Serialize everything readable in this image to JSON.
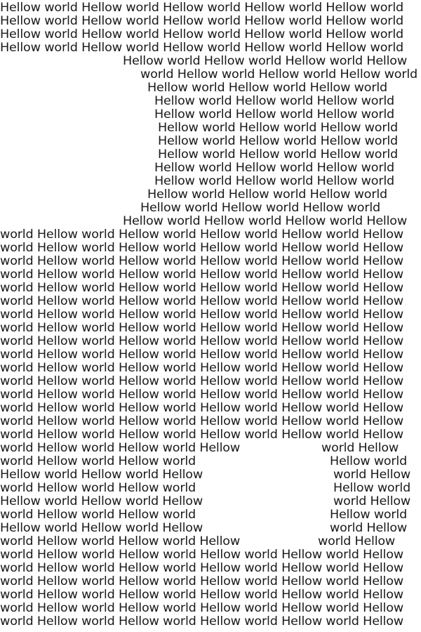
{
  "lines": [
    {
      "segments": [
        "Hellow world Hellow world Hellow world Hellow world Hellow world"
      ]
    },
    {
      "segments": [
        "Hellow world Hellow world Hellow world Hellow world Hellow world"
      ]
    },
    {
      "segments": [
        "Hellow world Hellow world Hellow world Hellow world Hellow world"
      ]
    },
    {
      "segments": [
        "Hellow world Hellow world Hellow world Hellow world Hellow world"
      ]
    },
    {
      "segments": [
        "Hellow world Hellow world Hellow world Hellow"
      ]
    },
    {
      "segments": [
        "world Hellow world Hellow world Hellow world"
      ]
    },
    {
      "segments": [
        "Hellow world Hellow world Hellow world"
      ]
    },
    {
      "segments": [
        "Hellow world Hellow world Hellow world"
      ]
    },
    {
      "segments": [
        "Hellow world Hellow world Hellow world"
      ]
    },
    {
      "segments": [
        "Hellow world Hellow world Hellow world"
      ]
    },
    {
      "segments": [
        "Hellow world Hellow world Hellow world"
      ]
    },
    {
      "segments": [
        "Hellow world Hellow world Hellow world"
      ]
    },
    {
      "segments": [
        "Hellow world Hellow world Hellow world"
      ]
    },
    {
      "segments": [
        "Hellow world Hellow world Hellow world"
      ]
    },
    {
      "segments": [
        "Hellow world Hellow world Hellow world"
      ]
    },
    {
      "segments": [
        "Hellow world Hellow world Hellow world"
      ]
    },
    {
      "segments": [
        "Hellow world Hellow world Hellow world Hellow"
      ]
    },
    {
      "segments": [
        "world Hellow world Hellow world Hellow world Hellow world Hellow"
      ]
    },
    {
      "segments": [
        "world Hellow world Hellow world Hellow world Hellow world Hellow"
      ]
    },
    {
      "segments": [
        "world Hellow world Hellow world Hellow world Hellow world Hellow"
      ]
    },
    {
      "segments": [
        "world Hellow world Hellow world Hellow world Hellow world Hellow"
      ]
    },
    {
      "segments": [
        "world Hellow world Hellow world Hellow world Hellow world Hellow"
      ]
    },
    {
      "segments": [
        "world Hellow world Hellow world Hellow world Hellow world Hellow"
      ]
    },
    {
      "segments": [
        "world Hellow world Hellow world Hellow world Hellow world Hellow"
      ]
    },
    {
      "segments": [
        "world Hellow world Hellow world Hellow world Hellow world Hellow"
      ]
    },
    {
      "segments": [
        "world Hellow world Hellow world Hellow world Hellow world Hellow"
      ]
    },
    {
      "segments": [
        "world Hellow world Hellow world Hellow world Hellow world Hellow"
      ]
    },
    {
      "segments": [
        "world Hellow world Hellow world Hellow world Hellow world Hellow"
      ]
    },
    {
      "segments": [
        "world Hellow world Hellow world Hellow world Hellow world Hellow"
      ]
    },
    {
      "segments": [
        "world Hellow world Hellow world Hellow world Hellow world Hellow"
      ]
    },
    {
      "segments": [
        "world Hellow world Hellow world Hellow world Hellow world Hellow"
      ]
    },
    {
      "segments": [
        "world Hellow world Hellow world Hellow world Hellow world Hellow"
      ]
    },
    {
      "segments": [
        "world Hellow world Hellow world Hellow world Hellow world Hellow"
      ]
    },
    {
      "segments": [
        "world Hellow world Hellow world Hellow",
        "world Hellow"
      ]
    },
    {
      "segments": [
        "world Hellow world Hellow world",
        "Hellow world"
      ]
    },
    {
      "segments": [
        "Hellow world Hellow world Hellow",
        "world Hellow"
      ]
    },
    {
      "segments": [
        "world Hellow world Hellow world",
        "Hellow world"
      ]
    },
    {
      "segments": [
        "Hellow world Hellow world Hellow",
        "world Hellow"
      ]
    },
    {
      "segments": [
        "world Hellow world Hellow world",
        "Hellow world"
      ]
    },
    {
      "segments": [
        "Hellow world Hellow world Hellow",
        "world Hellow"
      ]
    },
    {
      "segments": [
        "world Hellow world Hellow world Hellow",
        "world Hellow"
      ]
    },
    {
      "segments": [
        "world Hellow world Hellow world Hellow world Hellow world Hellow"
      ]
    },
    {
      "segments": [
        "world Hellow world Hellow world Hellow world Hellow world Hellow"
      ]
    },
    {
      "segments": [
        "world Hellow world Hellow world Hellow world Hellow world Hellow"
      ]
    },
    {
      "segments": [
        "world Hellow world Hellow world Hellow world Hellow world Hellow"
      ]
    },
    {
      "segments": [
        "world Hellow world Hellow world Hellow world Hellow world Hellow"
      ]
    },
    {
      "segments": [
        "world Hellow world Hellow world Hellow world Hellow world Hellow"
      ]
    }
  ]
}
